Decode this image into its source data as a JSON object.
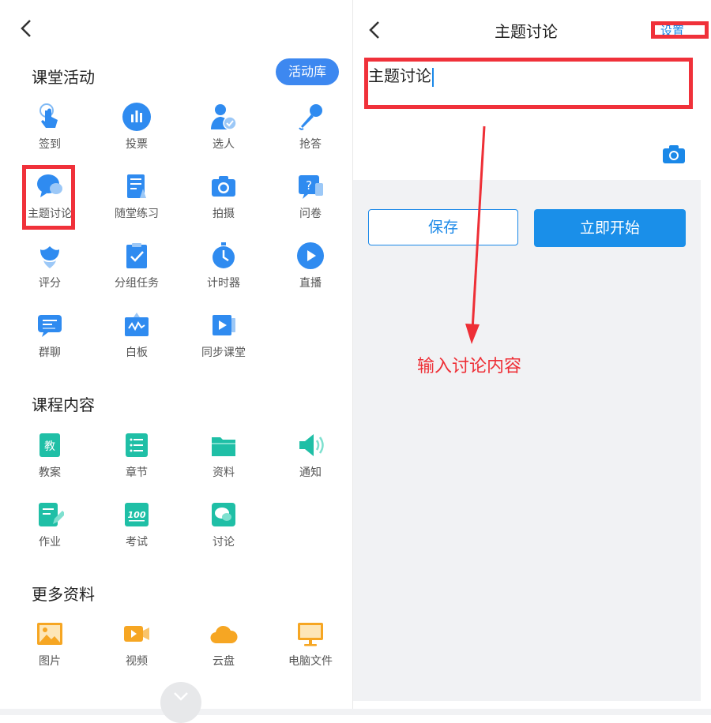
{
  "left_panel": {
    "activity_title": "课堂活动",
    "activity_library_button": "活动库",
    "course_title": "课程内容",
    "more_title": "更多资料",
    "activities": [
      {
        "label": "签到",
        "icon": "tap-icon"
      },
      {
        "label": "投票",
        "icon": "bar-chart-icon"
      },
      {
        "label": "选人",
        "icon": "user-check-icon"
      },
      {
        "label": "抢答",
        "icon": "microphone-icon"
      },
      {
        "label": "主题讨论",
        "icon": "chat-bubble-icon"
      },
      {
        "label": "随堂练习",
        "icon": "quiz-icon"
      },
      {
        "label": "拍摄",
        "icon": "camera-icon"
      },
      {
        "label": "问卷",
        "icon": "question-icon"
      },
      {
        "label": "评分",
        "icon": "tulip-icon"
      },
      {
        "label": "分组任务",
        "icon": "clipboard-check-icon"
      },
      {
        "label": "计时器",
        "icon": "stopwatch-icon"
      },
      {
        "label": "直播",
        "icon": "play-icon"
      },
      {
        "label": "群聊",
        "icon": "group-chat-icon"
      },
      {
        "label": "白板",
        "icon": "whiteboard-icon"
      },
      {
        "label": "同步课堂",
        "icon": "sync-class-icon"
      }
    ],
    "course_items": [
      {
        "label": "教案",
        "icon": "lesson-plan-icon",
        "glyph": "教"
      },
      {
        "label": "章节",
        "icon": "chapter-list-icon"
      },
      {
        "label": "资料",
        "icon": "folder-icon"
      },
      {
        "label": "通知",
        "icon": "speaker-icon"
      },
      {
        "label": "作业",
        "icon": "homework-icon"
      },
      {
        "label": "考试",
        "icon": "exam-icon",
        "glyph": "100"
      },
      {
        "label": "讨论",
        "icon": "discussion-icon"
      }
    ],
    "more_items": [
      {
        "label": "图片",
        "icon": "image-icon"
      },
      {
        "label": "视频",
        "icon": "video-icon"
      },
      {
        "label": "云盘",
        "icon": "cloud-icon"
      },
      {
        "label": "电脑文件",
        "icon": "monitor-icon"
      }
    ]
  },
  "right_panel": {
    "title": "主题讨论",
    "settings_link": "设置",
    "topic_input_value": "主题讨论",
    "save_button": "保存",
    "start_button": "立即开始",
    "annotation": "输入讨论内容"
  },
  "colors": {
    "accent_blue": "#1a88e8",
    "teal": "#1fbfa6",
    "orange": "#f6a623",
    "highlight_red": "#f0313a",
    "panel_gray": "#f1f2f4"
  }
}
